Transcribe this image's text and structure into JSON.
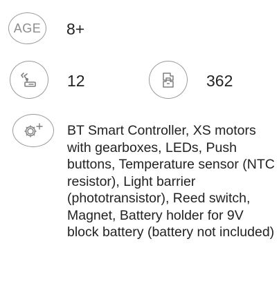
{
  "age": {
    "icon_label": "AGE",
    "value": "8+"
  },
  "models": {
    "icon": "robot-arm-icon",
    "value": "12"
  },
  "parts": {
    "icon": "building-blocks-icon",
    "value": "362"
  },
  "components": {
    "icon": "gear-plus-icon",
    "description": "BT Smart Controller, XS motors with gearboxes, LEDs, Push buttons, Temperature sensor (NTC resistor), Light barrier (phototransistor), Reed switch, Magnet, Battery holder for 9V block battery (battery not included)"
  },
  "colors": {
    "icon_stroke": "#9a9a9a",
    "text": "#222222"
  }
}
